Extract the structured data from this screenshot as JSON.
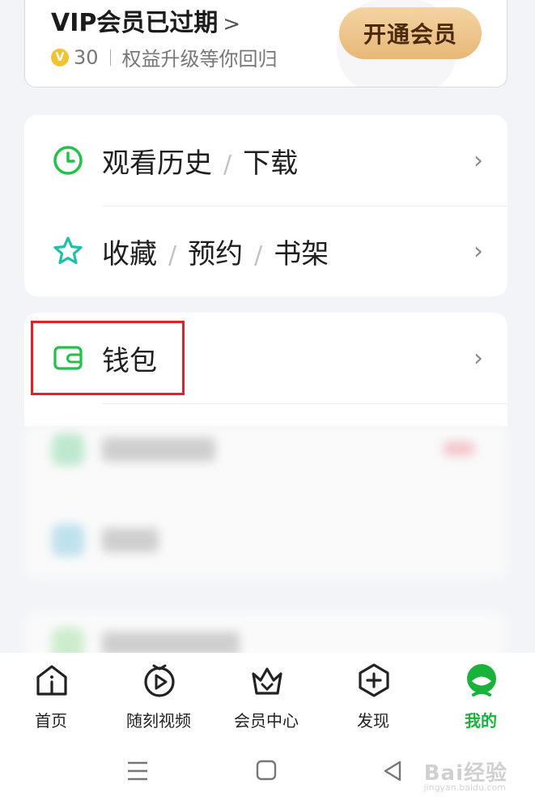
{
  "vip": {
    "title": "VIP会员已过期",
    "title_chevron": ">",
    "coins": "30",
    "coin_symbol": "V",
    "subtitle": "权益升级等你回归",
    "open_button": "开通会员"
  },
  "menu_group_1": [
    {
      "parts": [
        "观看历史",
        "下载"
      ],
      "icon": "clock-icon"
    },
    {
      "parts": [
        "收藏",
        "预约",
        "书架"
      ],
      "icon": "star-icon"
    }
  ],
  "menu_group_2": [
    {
      "label": "钱包",
      "icon": "wallet-icon"
    }
  ],
  "separator": "/",
  "arrow": "›",
  "tabs": [
    {
      "label": "首页",
      "icon": "home-icon"
    },
    {
      "label": "随刻视频",
      "icon": "play-icon"
    },
    {
      "label": "会员中心",
      "icon": "vip-crown-icon"
    },
    {
      "label": "发现",
      "icon": "plus-hexagon-icon"
    },
    {
      "label": "我的",
      "icon": "profile-icon",
      "active": true
    }
  ],
  "watermark": {
    "text": "Bai经验",
    "sub": "jingyan.baidu.com"
  },
  "colors": {
    "accent_green": "#19b23b",
    "highlight_red": "#e0202a",
    "gold": "#e7b777"
  }
}
